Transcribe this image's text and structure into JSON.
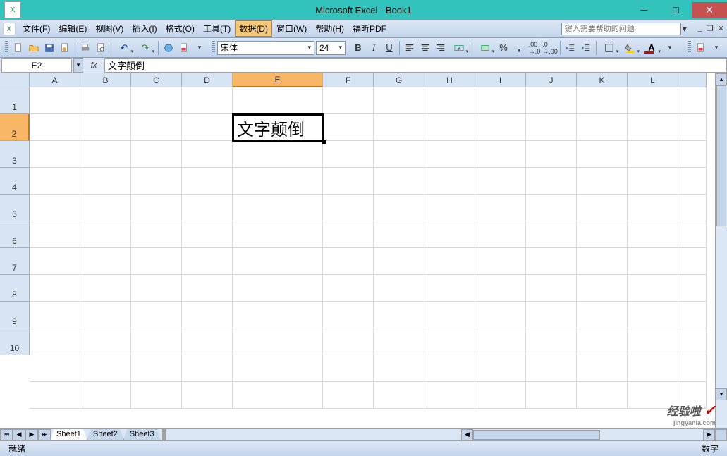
{
  "title": "Microsoft Excel - Book1",
  "menus": [
    "文件(F)",
    "编辑(E)",
    "视图(V)",
    "插入(I)",
    "格式(O)",
    "工具(T)",
    "数据(D)",
    "窗口(W)",
    "帮助(H)",
    "福昕PDF"
  ],
  "active_menu_index": 6,
  "help_placeholder": "键入需要帮助的问题",
  "font_name": "宋体",
  "font_size": "24",
  "name_box": "E2",
  "formula": "文字颠倒",
  "fx_label": "fx",
  "columns": [
    "A",
    "B",
    "C",
    "D",
    "E",
    "F",
    "G",
    "H",
    "I",
    "J",
    "K",
    "L"
  ],
  "active_col": "E",
  "rows": [
    "1",
    "2",
    "3",
    "4",
    "5",
    "6",
    "7",
    "8",
    "9",
    "10"
  ],
  "active_row": "2",
  "active_cell_value": "文字颠倒",
  "sheets": [
    "Sheet1",
    "Sheet2",
    "Sheet3"
  ],
  "active_sheet_index": 0,
  "status_left": "就绪",
  "status_right": "数字",
  "watermark_main": "经验啦",
  "watermark_sub": "jingyanla.com"
}
